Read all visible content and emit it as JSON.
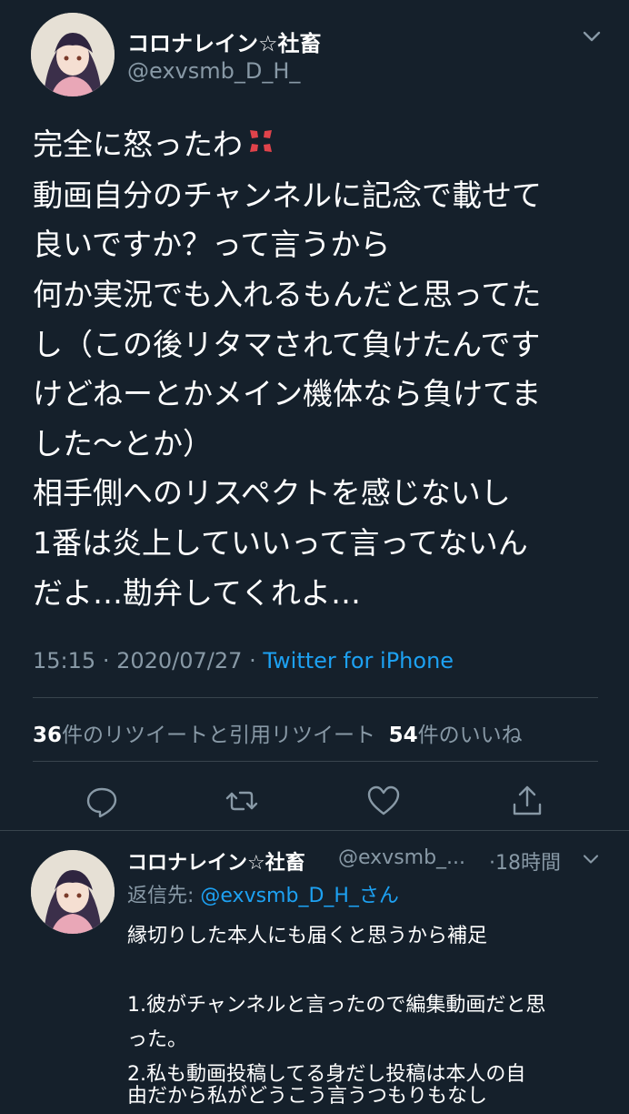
{
  "tweet": {
    "display_name": "コロナレイン☆社畜",
    "handle": "@exvsmb_D_H_",
    "lines": [
      "完全に怒ったわ",
      "動画自分のチャンネルに記念で載せて",
      "良いですか？って言うから",
      "何か実況でも入れるもんだと思ってた",
      "し（この後リタマされて負けたんです",
      "けどねーとかメイン機体なら負けてま",
      "した〜とか）",
      "相手側へのリスペクトを感じないし",
      "1番は炎上していいって言ってないん",
      "だよ…勘弁してくれよ…"
    ],
    "time": "15:15",
    "date": "2020/07/27",
    "separator": "·",
    "source": "Twitter for iPhone",
    "retweet_count": "36",
    "retweet_label": "件のリツイートと引用リツイート",
    "like_count": "54",
    "like_label": "件のいいね"
  },
  "reply": {
    "display_name": "コロナレイン☆社畜",
    "handle": "@exvsmb_...",
    "time_ago": "·18時間",
    "replying_to_prefix": "返信先: ",
    "replying_to_handle": "@exvsmb_D_H_さん",
    "lines": [
      "縁切りした本人にも届くと思うから補足",
      "",
      "1.彼がチャンネルと言ったので編集動画だと思",
      "った。",
      "2.私も動画投稿してる身だし投稿は本人の自",
      "由だから私がどうこう言うつもりもなし"
    ]
  },
  "icons": [
    "chevron-down-icon",
    "anger-emoji-icon",
    "reply-icon",
    "retweet-icon",
    "like-icon",
    "share-icon"
  ],
  "colors": {
    "background": "#15202b",
    "secondary_text": "#8899a6",
    "link": "#1da1f2",
    "divider": "#38444d"
  }
}
